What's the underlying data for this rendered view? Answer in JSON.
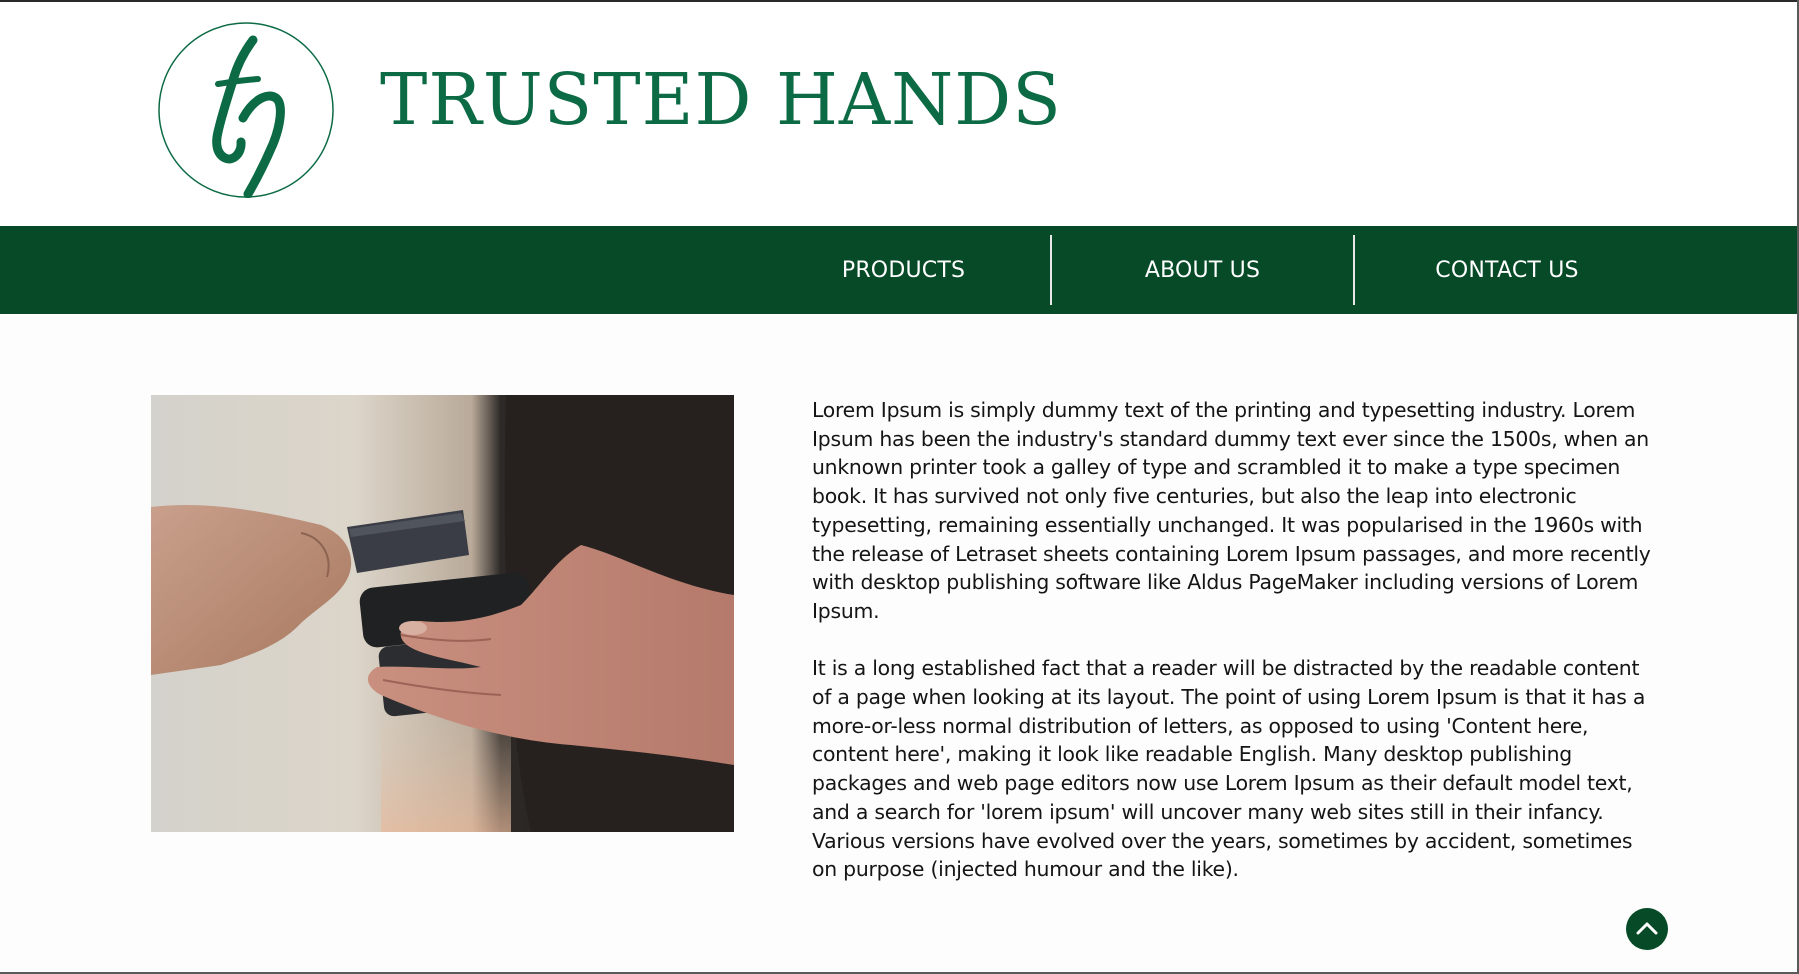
{
  "brand": {
    "title": "TRUSTED HANDS",
    "logo_icon": "th-monogram-logo"
  },
  "nav": {
    "items": [
      {
        "label": "PRODUCTS"
      },
      {
        "label": "ABOUT US"
      },
      {
        "label": "CONTACT US"
      }
    ]
  },
  "hero_image": {
    "subject": "hand-holding-card-and-phone-photo"
  },
  "content": {
    "paragraphs": [
      "Lorem Ipsum is simply dummy text of the printing and typesetting industry. Lorem Ipsum has been the industry's standard dummy text ever since the 1500s, when an unknown printer took a galley of type and scrambled it to make a type specimen book. It has survived not only five centuries, but also the leap into electronic typesetting, remaining essentially unchanged. It was popularised in the 1960s with the release of Letraset sheets containing Lorem Ipsum passages, and more recently with desktop publishing software like Aldus PageMaker including versions of Lorem Ipsum.",
      "It is a long established fact that a reader will be distracted by the readable content of a page when looking at its layout. The point of using Lorem Ipsum is that it has a more-or-less normal distribution of letters, as opposed to using 'Content here, content here', making it look like readable English. Many desktop publishing packages and web page editors now use Lorem Ipsum as their default model text, and a search for 'lorem ipsum' will uncover many web sites still in their infancy. Various versions have evolved over the years, sometimes by accident, sometimes on purpose (injected humour and the like)."
    ]
  },
  "scroll_top": {
    "icon": "chevron-up-icon"
  },
  "colors": {
    "brand_green": "#0c6b45",
    "nav_green": "#064a27",
    "text": "#151515",
    "background": "#fdfdfd"
  }
}
